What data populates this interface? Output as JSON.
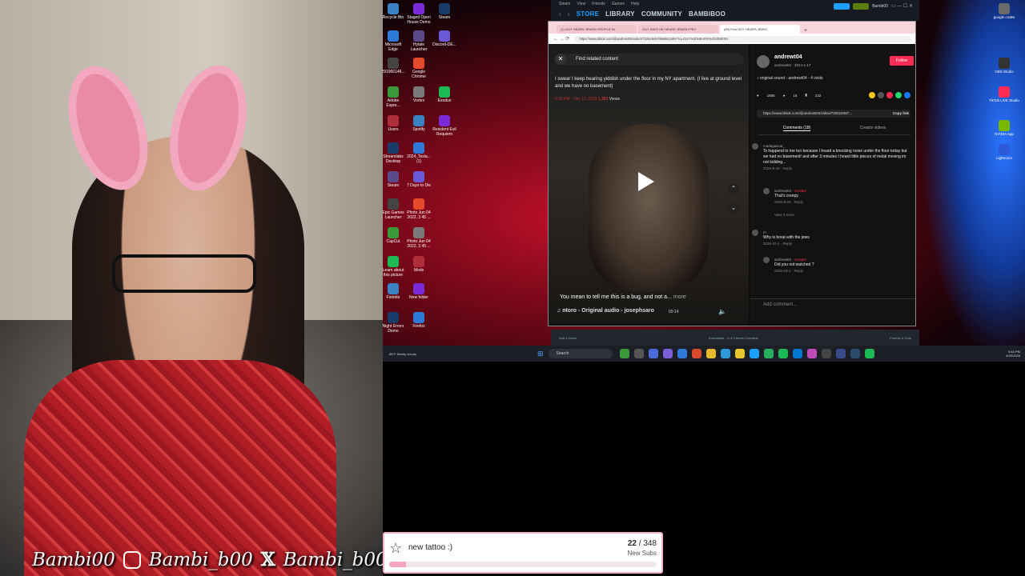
{
  "webcam": {
    "social_handles": [
      "Bambi00",
      "Bambi_b00",
      "Bambi_b00"
    ]
  },
  "desktop_icons": [
    {
      "label": "Recycle Bin"
    },
    {
      "label": "Staged Open House Demo"
    },
    {
      "label": "Steam"
    },
    {
      "label": "Microsoft Edge"
    },
    {
      "label": "Hytale Launcher"
    },
    {
      "label": "Discord-DE..."
    },
    {
      "label": "291966148..."
    },
    {
      "label": "Google Chrome"
    },
    {
      "label": "Adobe Expre..."
    },
    {
      "label": "Vortex"
    },
    {
      "label": "Exodus"
    },
    {
      "label": "Users"
    },
    {
      "label": "Spotify"
    },
    {
      "label": "Resident Evil Requiem"
    },
    {
      "label": "Streamlabs Desktop"
    },
    {
      "label": "2024_Tesla... (1)"
    },
    {
      "label": "Steam"
    },
    {
      "label": "7 Days to Die"
    },
    {
      "label": "Epic Games Launcher"
    },
    {
      "label": "Photo Jun 04 2022, 3 45 ..."
    },
    {
      "label": "CapCut"
    },
    {
      "label": "Photo Jun 04 2022, 3 45 ..."
    },
    {
      "label": "Learn about this picture"
    },
    {
      "label": "Mods"
    },
    {
      "label": "Fortnite"
    },
    {
      "label": "New folder"
    },
    {
      "label": "Night Errors Demo"
    },
    {
      "label": "Firefox"
    }
  ],
  "right_icons": [
    {
      "label": "google codes"
    },
    {
      "label": "OBS Studio"
    },
    {
      "label": "TikTok LIVE Studio"
    },
    {
      "label": "NVIDIA App"
    },
    {
      "label": "Lightroom"
    }
  ],
  "steam": {
    "menu": [
      "Steam",
      "View",
      "Friends",
      "Games",
      "Help"
    ],
    "nav": [
      "STORE",
      "LIBRARY",
      "COMMUNITY",
      "BAMBIBOO"
    ],
    "user": "Bambi00",
    "add_game": "Add a Game",
    "downloads": "Downloads - 3 of 3 Items Complete",
    "friends": "Friends & Chat"
  },
  "browser": {
    "tabs": [
      "(1) GUY HEARS JEWISH PEOPLE IN",
      "GUY SAYS HE HEARS JEWISH PEO",
      "(69) Find GUY HEARS JEWIS"
    ],
    "url": "https://www.tiktok.com/@andrewt04/video/7325194579565611857?q=GUY%20HEARS%20JEWISH"
  },
  "tiktok": {
    "find_placeholder": "Find related content",
    "caption": "I swear I keep hearing yiddish under the floor in my NY apartment. (I live at ground level and we have no basement)",
    "date": "5:32 PM · Dec 11, 2023",
    "views": "1,303",
    "views_label": "Views",
    "subtitle": "You mean to tell me this is a bug, and not a...",
    "more": "more",
    "music": "ntoro - Original audio - josephsaro",
    "time": "00:14",
    "username": "andrewt04",
    "user_meta": "andrewt04 · 2024-1-17",
    "follow": "Follow",
    "sound": "original sound - andrewt04 - 4 visits",
    "likes": "1856",
    "comments_count": "18",
    "saves": "232",
    "link": "https://www.tiktok.com/@andrewt04/video/732519457...",
    "copy_link": "Copy link",
    "tab_comments": "Comments (18)",
    "tab_creator": "Creator videos",
    "comments": [
      {
        "name": "madagascar_",
        "text": "Ts happend to me too because I heard a knocking noise under the floor today but we had no basement! and after 3 minutes I heard little pieces of metal moving im not kidding...",
        "date": "2025-8-29",
        "reply": "Reply"
      },
      {
        "name": "andrewt04 · ",
        "creator": "Creator",
        "text": "That's creepy",
        "date": "2025-8-29",
        "reply": "Reply"
      },
      {
        "name": "m",
        "text": "Why is borat with the jews",
        "date": "2025-10-1",
        "reply": "Reply"
      },
      {
        "name": "andrewt04 · ",
        "creator": "Creator",
        "text": "Did you not watched ?",
        "date": "2025-10-1",
        "reply": "Reply"
      }
    ],
    "view_more": "View 3 more",
    "add_comment": "Add comment..."
  },
  "taskbar": {
    "weather": "68°F Mostly cloudy",
    "search": "Search",
    "time": "5:44 PM",
    "date": "4/20/2026"
  },
  "sub_goal": {
    "title": "new tattoo :)",
    "current": "22",
    "separator": " / ",
    "target": "348",
    "label": "New Subs",
    "progress": 0.063
  }
}
